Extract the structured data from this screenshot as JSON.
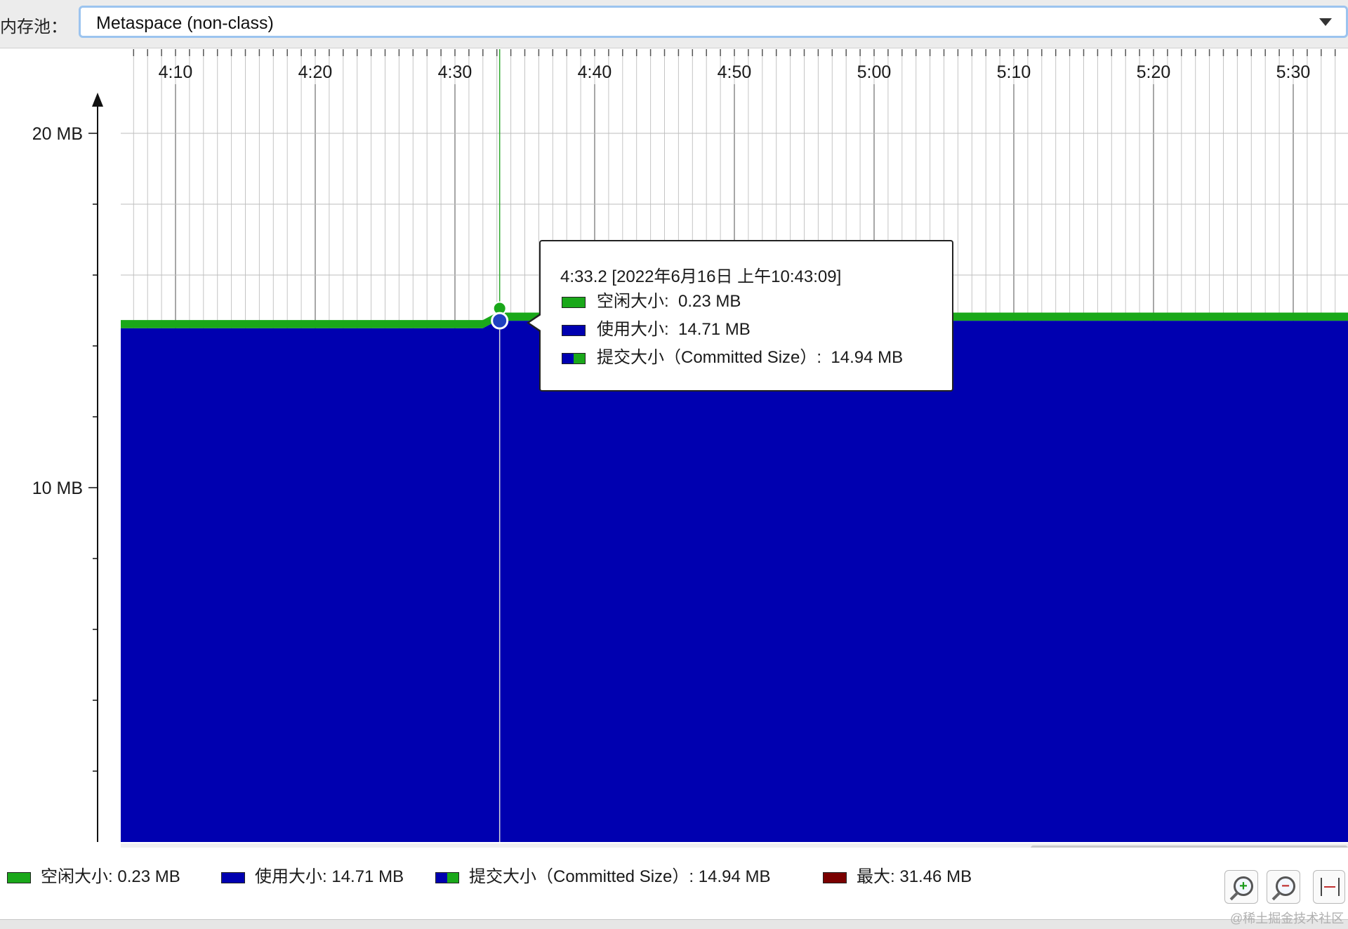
{
  "pool": {
    "label": "内存池：",
    "selected": "Metaspace (non-class)"
  },
  "chart_data": {
    "type": "area",
    "x_tick_labels": [
      "4:10",
      "4:20",
      "4:30",
      "4:40",
      "4:50",
      "5:00",
      "5:10",
      "5:20",
      "5:30"
    ],
    "y_tick_labels": [
      "20 MB",
      "10 MB"
    ],
    "series": [
      {
        "name": "使用大小",
        "color": "#0000b0",
        "points": [
          {
            "x": "4:07",
            "y": 14.5
          },
          {
            "x": "4:32",
            "y": 14.5
          },
          {
            "x": "4:33",
            "y": 14.71
          },
          {
            "x": "5:35",
            "y": 14.71
          }
        ]
      },
      {
        "name": "空闲大小",
        "color": "#1aa81a",
        "points": [
          {
            "x": "4:07",
            "y": 0.23
          },
          {
            "x": "5:35",
            "y": 0.23
          }
        ]
      }
    ],
    "marker": {
      "x": "4:33.2"
    },
    "tooltip": {
      "title": "4:33.2 [2022年6月16日 上午10:43:09]",
      "rows": [
        {
          "label": "空闲大小:",
          "value": "0.23 MB",
          "swatch": "green"
        },
        {
          "label": "使用大小:",
          "value": "14.71 MB",
          "swatch": "blue"
        },
        {
          "label": "提交大小（Committed Size）:",
          "value": "14.94 MB",
          "swatch": "split"
        }
      ]
    }
  },
  "legend": [
    {
      "label": "空闲大小:",
      "value": "0.23 MB",
      "swatch": "green"
    },
    {
      "label": "使用大小:",
      "value": "14.71 MB",
      "swatch": "blue"
    },
    {
      "label": "提交大小（Committed Size）:",
      "value": "14.94 MB",
      "swatch": "split"
    },
    {
      "label": "最大:",
      "value": "31.46 MB",
      "swatch": "red"
    }
  ],
  "colors": {
    "used": "#0000b0",
    "free": "#1aa81a",
    "max": "#7a0000"
  },
  "watermark": "@稀土掘金技术社区",
  "icons": [
    "zoom-in-icon",
    "zoom-out-icon",
    "fit-icon"
  ]
}
